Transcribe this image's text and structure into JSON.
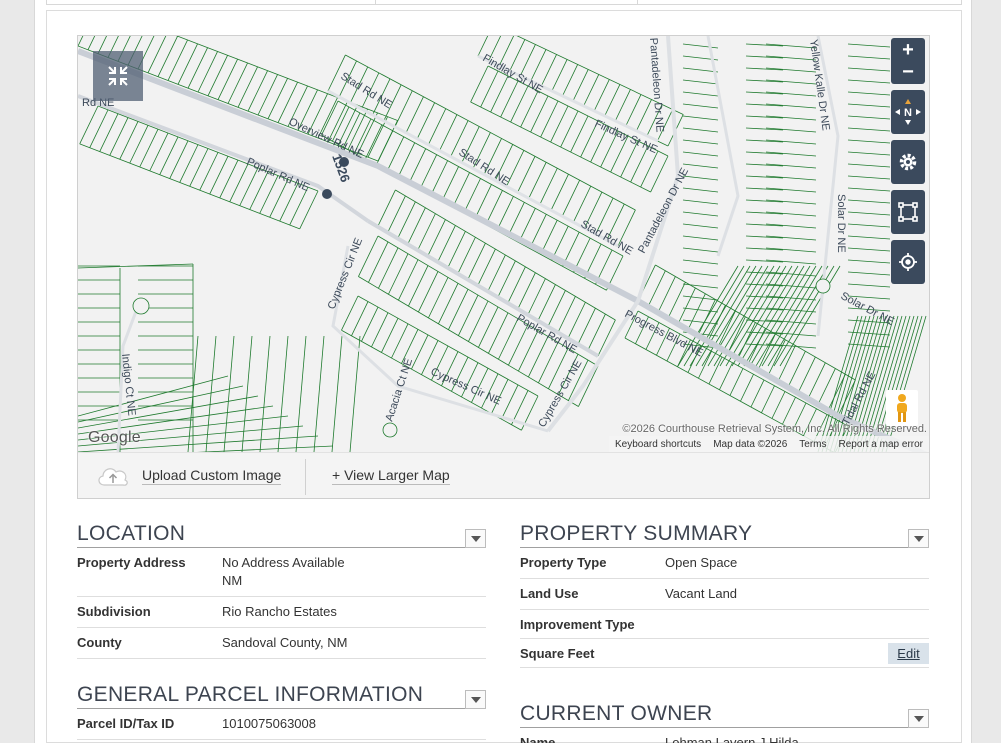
{
  "map": {
    "streets": [
      {
        "label": "Overview Rd NE"
      },
      {
        "label": "Poplar Rd NE"
      },
      {
        "label": "Poplar Rd NE"
      },
      {
        "label": "Progress Blvd NE"
      },
      {
        "label": "Stad Rd NE"
      },
      {
        "label": "Stad Rd NE"
      },
      {
        "label": "Stad Rd NE"
      },
      {
        "label": "Findlay St NE"
      },
      {
        "label": "Findlay St NE"
      },
      {
        "label": "Pantadeleon Dr NE"
      },
      {
        "label": "Pantadeleon Dr NE"
      },
      {
        "label": "Cypress Cir NE"
      },
      {
        "label": "Cypress Cir NE"
      },
      {
        "label": "Cypress Cir NE"
      },
      {
        "label": "Acacia Ct NE"
      },
      {
        "label": "Indigo Ct NE"
      },
      {
        "label": "Solar Dr NE"
      },
      {
        "label": "Solar Dr NE"
      },
      {
        "label": "Rd NE"
      },
      {
        "label": "Tidal Rd NE"
      },
      {
        "label": "Yellow Kalle Dr NE"
      }
    ],
    "parcel_marker": "1526",
    "google_label": "Google",
    "copyright": "©2026 Courthouse Retrieval System, Inc. All Rights Reserved.",
    "footer_links": [
      "Keyboard shortcuts",
      "Map data ©2026",
      "Terms",
      "Report a map error"
    ],
    "zoom_in": "+",
    "zoom_out": "−",
    "compass_label": "N",
    "colors": {
      "parcel_lines": "#1f7a2e",
      "road": "#c9ced6",
      "controls": "#3b4a5d"
    }
  },
  "toolbar": {
    "upload_label": "Upload Custom Image",
    "view_larger_label": "+ View Larger Map"
  },
  "location": {
    "title": "LOCATION",
    "rows": [
      {
        "key": "Property Address",
        "value": "No Address Available",
        "value2": "NM"
      },
      {
        "key": "Subdivision",
        "value": "Rio Rancho Estates"
      },
      {
        "key": "County",
        "value": "Sandoval County, NM"
      }
    ]
  },
  "general": {
    "title": "GENERAL PARCEL INFORMATION",
    "rows": [
      {
        "key": "Parcel ID/Tax ID",
        "value": "1010075063008"
      }
    ]
  },
  "summary": {
    "title": "PROPERTY SUMMARY",
    "rows": [
      {
        "key": "Property Type",
        "value": "Open Space"
      },
      {
        "key": "Land Use",
        "value": "Vacant Land"
      },
      {
        "key": "Improvement Type",
        "value": ""
      },
      {
        "key": "Square Feet",
        "value": "",
        "action": "Edit"
      }
    ]
  },
  "owner": {
    "title": "CURRENT OWNER",
    "rows": [
      {
        "key": "Name",
        "value": "Lohman Lavern J Hilda"
      }
    ]
  }
}
